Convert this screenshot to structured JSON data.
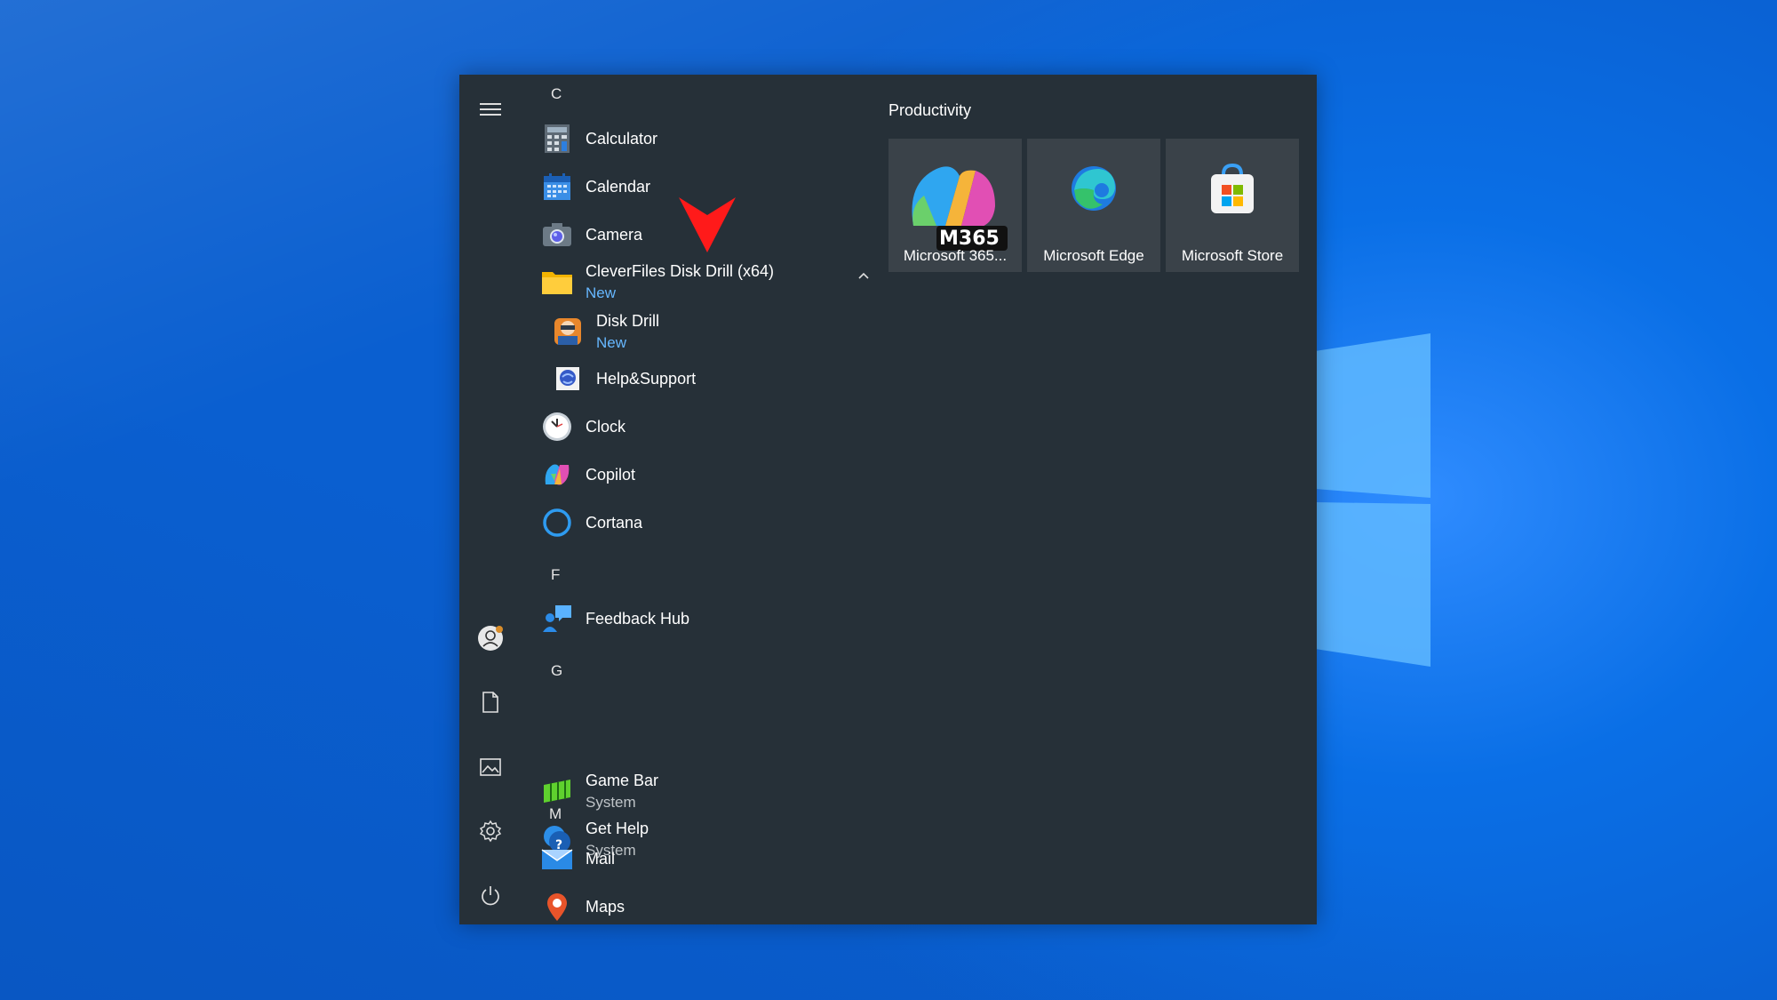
{
  "start_menu": {
    "groups": [
      {
        "letter": "C"
      },
      {
        "letter": "F"
      },
      {
        "letter": "G"
      },
      {
        "letter": "M"
      }
    ],
    "apps": [
      {
        "name": "Calculator",
        "sub": ""
      },
      {
        "name": "Calendar",
        "sub": ""
      },
      {
        "name": "Camera",
        "sub": ""
      },
      {
        "name": "CleverFiles Disk Drill (x64)",
        "sub": "New"
      },
      {
        "name": "Disk Drill",
        "sub": "New"
      },
      {
        "name": "Help&Support",
        "sub": ""
      },
      {
        "name": "Clock",
        "sub": ""
      },
      {
        "name": "Copilot",
        "sub": ""
      },
      {
        "name": "Cortana",
        "sub": ""
      },
      {
        "name": "Feedback Hub",
        "sub": ""
      },
      {
        "name": "Game Bar",
        "sub": "System"
      },
      {
        "name": "Get Help",
        "sub": "System"
      },
      {
        "name": "Mail",
        "sub": ""
      },
      {
        "name": "Maps",
        "sub": ""
      }
    ],
    "tiles_group_title": "Productivity",
    "tiles": [
      {
        "label": "Microsoft 365...",
        "badge": "M365"
      },
      {
        "label": "Microsoft Edge"
      },
      {
        "label": "Microsoft Store"
      }
    ]
  },
  "colors": {
    "menu_bg": "#263038",
    "tile_bg": "#3a4249",
    "accent_new": "#66b7ff",
    "annotation_arrow": "#ff1a1a"
  }
}
